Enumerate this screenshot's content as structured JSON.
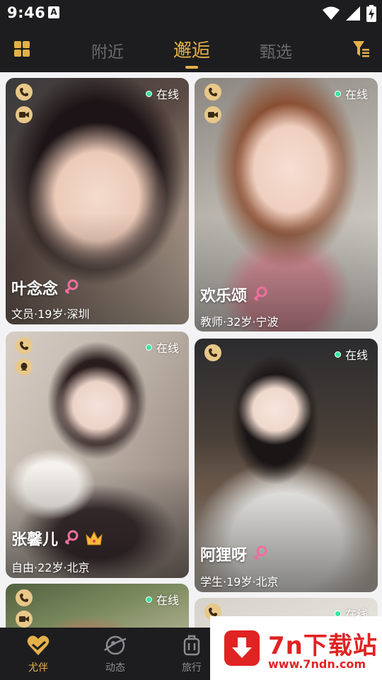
{
  "status_bar": {
    "time": "9:46",
    "notification_icon": "A"
  },
  "header": {
    "tabs": [
      {
        "label": "附近",
        "active": false
      },
      {
        "label": "邂逅",
        "active": true
      },
      {
        "label": "甄选",
        "active": false
      }
    ]
  },
  "cards": [
    {
      "name": "叶念念",
      "meta": "文员·19岁·深圳",
      "status": "在线",
      "vip": false,
      "badges": [
        "phone-icon",
        "video-icon"
      ]
    },
    {
      "name": "欢乐颂",
      "meta": "教师·32岁·宁波",
      "status": "在线",
      "vip": false,
      "badges": [
        "phone-icon",
        "video-icon"
      ]
    },
    {
      "name": "张馨儿",
      "meta": "自由·22岁·北京",
      "status": "在线",
      "vip": true,
      "badges": [
        "phone-icon",
        "qq-icon"
      ]
    },
    {
      "name": "阿狸呀",
      "meta": "学生·19岁·北京",
      "status": "在线",
      "vip": false,
      "badges": [
        "phone-icon"
      ]
    },
    {
      "status": "在线",
      "badges": [
        "phone-icon",
        "video-icon"
      ]
    },
    {
      "status": "在线",
      "badges": [
        "phone-icon"
      ]
    }
  ],
  "bottom_nav": [
    {
      "label": "尤伴",
      "icon": "heart-icon",
      "active": true
    },
    {
      "label": "动态",
      "icon": "planet-icon",
      "active": false
    },
    {
      "label": "旅行",
      "icon": "luggage-icon",
      "active": false
    }
  ],
  "watermark": {
    "title": "7n下载站",
    "url": "www.7ndn.com"
  },
  "colors": {
    "accent": "#e4b04a",
    "online": "#37e6a0",
    "background": "#1d1d1f",
    "female": "#f06ea0"
  }
}
